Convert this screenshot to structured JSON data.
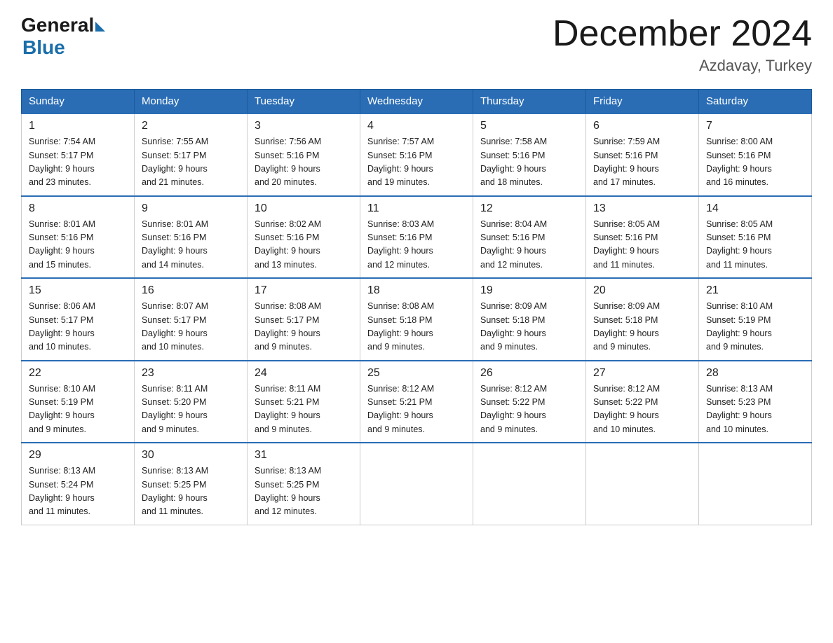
{
  "header": {
    "logo_general": "General",
    "logo_blue": "Blue",
    "month_title": "December 2024",
    "location": "Azdavay, Turkey"
  },
  "columns": [
    "Sunday",
    "Monday",
    "Tuesday",
    "Wednesday",
    "Thursday",
    "Friday",
    "Saturday"
  ],
  "weeks": [
    [
      {
        "day": "1",
        "info": "Sunrise: 7:54 AM\nSunset: 5:17 PM\nDaylight: 9 hours\nand 23 minutes."
      },
      {
        "day": "2",
        "info": "Sunrise: 7:55 AM\nSunset: 5:17 PM\nDaylight: 9 hours\nand 21 minutes."
      },
      {
        "day": "3",
        "info": "Sunrise: 7:56 AM\nSunset: 5:16 PM\nDaylight: 9 hours\nand 20 minutes."
      },
      {
        "day": "4",
        "info": "Sunrise: 7:57 AM\nSunset: 5:16 PM\nDaylight: 9 hours\nand 19 minutes."
      },
      {
        "day": "5",
        "info": "Sunrise: 7:58 AM\nSunset: 5:16 PM\nDaylight: 9 hours\nand 18 minutes."
      },
      {
        "day": "6",
        "info": "Sunrise: 7:59 AM\nSunset: 5:16 PM\nDaylight: 9 hours\nand 17 minutes."
      },
      {
        "day": "7",
        "info": "Sunrise: 8:00 AM\nSunset: 5:16 PM\nDaylight: 9 hours\nand 16 minutes."
      }
    ],
    [
      {
        "day": "8",
        "info": "Sunrise: 8:01 AM\nSunset: 5:16 PM\nDaylight: 9 hours\nand 15 minutes."
      },
      {
        "day": "9",
        "info": "Sunrise: 8:01 AM\nSunset: 5:16 PM\nDaylight: 9 hours\nand 14 minutes."
      },
      {
        "day": "10",
        "info": "Sunrise: 8:02 AM\nSunset: 5:16 PM\nDaylight: 9 hours\nand 13 minutes."
      },
      {
        "day": "11",
        "info": "Sunrise: 8:03 AM\nSunset: 5:16 PM\nDaylight: 9 hours\nand 12 minutes."
      },
      {
        "day": "12",
        "info": "Sunrise: 8:04 AM\nSunset: 5:16 PM\nDaylight: 9 hours\nand 12 minutes."
      },
      {
        "day": "13",
        "info": "Sunrise: 8:05 AM\nSunset: 5:16 PM\nDaylight: 9 hours\nand 11 minutes."
      },
      {
        "day": "14",
        "info": "Sunrise: 8:05 AM\nSunset: 5:16 PM\nDaylight: 9 hours\nand 11 minutes."
      }
    ],
    [
      {
        "day": "15",
        "info": "Sunrise: 8:06 AM\nSunset: 5:17 PM\nDaylight: 9 hours\nand 10 minutes."
      },
      {
        "day": "16",
        "info": "Sunrise: 8:07 AM\nSunset: 5:17 PM\nDaylight: 9 hours\nand 10 minutes."
      },
      {
        "day": "17",
        "info": "Sunrise: 8:08 AM\nSunset: 5:17 PM\nDaylight: 9 hours\nand 9 minutes."
      },
      {
        "day": "18",
        "info": "Sunrise: 8:08 AM\nSunset: 5:18 PM\nDaylight: 9 hours\nand 9 minutes."
      },
      {
        "day": "19",
        "info": "Sunrise: 8:09 AM\nSunset: 5:18 PM\nDaylight: 9 hours\nand 9 minutes."
      },
      {
        "day": "20",
        "info": "Sunrise: 8:09 AM\nSunset: 5:18 PM\nDaylight: 9 hours\nand 9 minutes."
      },
      {
        "day": "21",
        "info": "Sunrise: 8:10 AM\nSunset: 5:19 PM\nDaylight: 9 hours\nand 9 minutes."
      }
    ],
    [
      {
        "day": "22",
        "info": "Sunrise: 8:10 AM\nSunset: 5:19 PM\nDaylight: 9 hours\nand 9 minutes."
      },
      {
        "day": "23",
        "info": "Sunrise: 8:11 AM\nSunset: 5:20 PM\nDaylight: 9 hours\nand 9 minutes."
      },
      {
        "day": "24",
        "info": "Sunrise: 8:11 AM\nSunset: 5:21 PM\nDaylight: 9 hours\nand 9 minutes."
      },
      {
        "day": "25",
        "info": "Sunrise: 8:12 AM\nSunset: 5:21 PM\nDaylight: 9 hours\nand 9 minutes."
      },
      {
        "day": "26",
        "info": "Sunrise: 8:12 AM\nSunset: 5:22 PM\nDaylight: 9 hours\nand 9 minutes."
      },
      {
        "day": "27",
        "info": "Sunrise: 8:12 AM\nSunset: 5:22 PM\nDaylight: 9 hours\nand 10 minutes."
      },
      {
        "day": "28",
        "info": "Sunrise: 8:13 AM\nSunset: 5:23 PM\nDaylight: 9 hours\nand 10 minutes."
      }
    ],
    [
      {
        "day": "29",
        "info": "Sunrise: 8:13 AM\nSunset: 5:24 PM\nDaylight: 9 hours\nand 11 minutes."
      },
      {
        "day": "30",
        "info": "Sunrise: 8:13 AM\nSunset: 5:25 PM\nDaylight: 9 hours\nand 11 minutes."
      },
      {
        "day": "31",
        "info": "Sunrise: 8:13 AM\nSunset: 5:25 PM\nDaylight: 9 hours\nand 12 minutes."
      },
      null,
      null,
      null,
      null
    ]
  ]
}
